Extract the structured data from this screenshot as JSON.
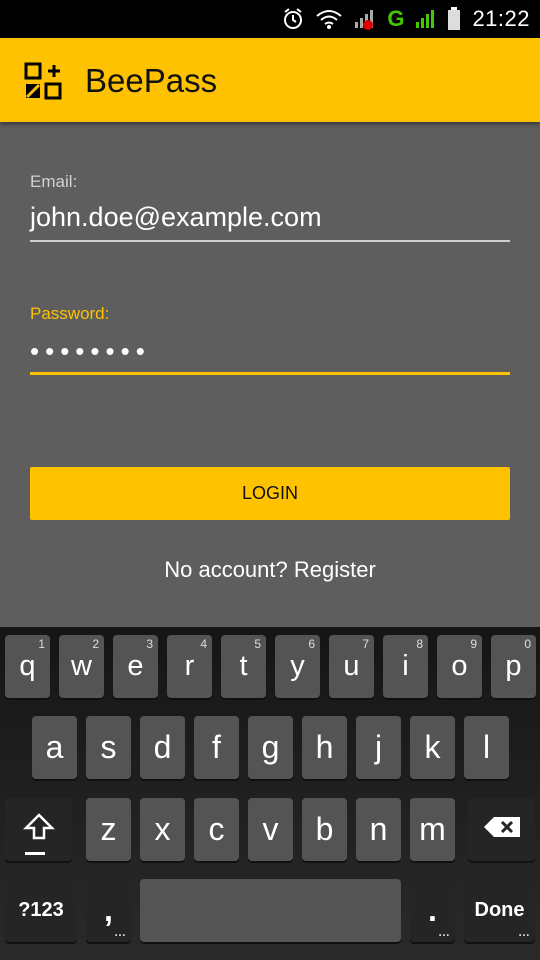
{
  "status_bar": {
    "network": "G",
    "time": "21:22"
  },
  "app": {
    "title": "BeePass",
    "colors": {
      "accent": "#ffc200",
      "background": "#5e5e5e",
      "keyboard": "#1b1b1b"
    }
  },
  "form": {
    "email_label": "Email:",
    "email_value": "john.doe@example.com",
    "password_label": "Password:",
    "password_value": "••••••••",
    "login_label": "LOGIN",
    "register_text": "No account? Register"
  },
  "keyboard": {
    "row1": [
      {
        "label": "q",
        "digit": "1"
      },
      {
        "label": "w",
        "digit": "2"
      },
      {
        "label": "e",
        "digit": "3"
      },
      {
        "label": "r",
        "digit": "4"
      },
      {
        "label": "t",
        "digit": "5"
      },
      {
        "label": "y",
        "digit": "6"
      },
      {
        "label": "u",
        "digit": "7"
      },
      {
        "label": "i",
        "digit": "8"
      },
      {
        "label": "o",
        "digit": "9"
      },
      {
        "label": "p",
        "digit": "0"
      }
    ],
    "row2": [
      "a",
      "s",
      "d",
      "f",
      "g",
      "h",
      "j",
      "k",
      "l"
    ],
    "row3": [
      "z",
      "x",
      "c",
      "v",
      "b",
      "n",
      "m"
    ],
    "bottom": {
      "symbols_label": "?123",
      "comma": ",",
      "period": ".",
      "done_label": "Done"
    }
  }
}
